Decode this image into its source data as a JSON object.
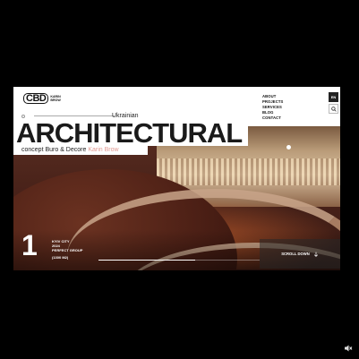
{
  "header": {
    "logo_mark": "CBD",
    "logo_line1": "KARIN",
    "logo_line2": "BROW",
    "nav": [
      "ABOUT",
      "PROJECTS",
      "SERVICES",
      "BLOG",
      "CONTACT"
    ],
    "lang": "EN"
  },
  "hero": {
    "kicker": "Ukrainian",
    "title": "ARCHITECTURAL",
    "subtitle": "concept Buro & Decore",
    "author": "Karin Brow"
  },
  "project": {
    "number": "1",
    "city": "KYIV CITY",
    "year": "2024",
    "group": "PERFECT GROUP",
    "area": "(1300 M2)",
    "progress": 0.6
  },
  "scroll": {
    "label": "SCROLL DOWN"
  },
  "colors": {
    "accent": "#e29a93",
    "dark": "#1a1a1a"
  },
  "icons": {
    "search": "search-icon",
    "scroll": "arrow-down-icon",
    "sound": "mute-icon"
  }
}
